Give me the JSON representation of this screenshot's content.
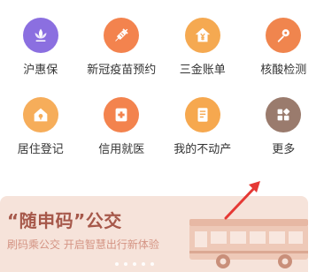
{
  "services": [
    {
      "label": "沪惠保",
      "icon": "lotus-icon",
      "color": "#8b6fe0"
    },
    {
      "label": "新冠疫苗预约",
      "icon": "syringe-icon",
      "color": "#f3834e"
    },
    {
      "label": "三金账单",
      "icon": "house-yen-icon",
      "color": "#f5a951"
    },
    {
      "label": "核酸检测",
      "icon": "test-swab-icon",
      "color": "#f0854e"
    },
    {
      "label": "居住登记",
      "icon": "home-pin-icon",
      "color": "#f6ad5a"
    },
    {
      "label": "信用就医",
      "icon": "medical-card-icon",
      "color": "#f3834e"
    },
    {
      "label": "我的不动产",
      "icon": "property-document-icon",
      "color": "#f6a84f"
    },
    {
      "label": "更多",
      "icon": "more-grid-icon",
      "color": "#9a7b6d"
    }
  ],
  "banner": {
    "title": "“随申码”公交",
    "subtitle": "刷码乘公交 开启智慧出行新体验",
    "carousel_dots": 5
  },
  "annotation": {
    "color": "#e53935"
  }
}
